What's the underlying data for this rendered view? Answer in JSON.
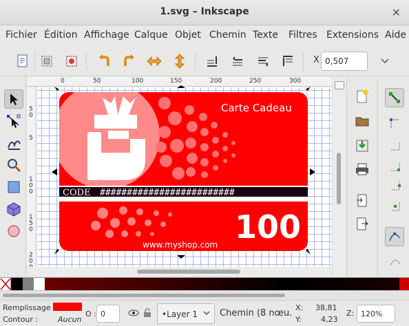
{
  "window": {
    "title": "1.svg – Inkscape",
    "close_glyph": "×"
  },
  "menu": {
    "items": [
      "Fichier",
      "Édition",
      "Affichage",
      "Calque",
      "Objet",
      "Chemin",
      "Texte",
      "Filtres",
      "Extensions",
      "Aide"
    ]
  },
  "toolbar": {
    "x_label": "X",
    "x_value": "0,507",
    "icons": [
      "document-properties-icon",
      "select-all-icon",
      "select-page-icon",
      "rotate-ccw-icon",
      "rotate-cw-icon",
      "flip-horizontal-icon",
      "flip-vertical-icon",
      "raise-to-top-icon",
      "raise-icon",
      "lower-icon",
      "lower-to-bottom-icon"
    ]
  },
  "rulers": {
    "top": [
      "0",
      "50",
      "100",
      "150",
      "200",
      "250",
      "300"
    ],
    "left": [
      "5",
      "0",
      "5",
      "1",
      "0",
      "0",
      "1",
      "5",
      "0",
      "2",
      "0",
      "0"
    ]
  },
  "card": {
    "title": "Carte Cadeau",
    "code_label": "CODE",
    "code_value": "#########################",
    "amount": "100",
    "url": "www.myshop.com",
    "colors": {
      "red": "#ff0000",
      "pink": "#ff8080",
      "dark": "#1a0010"
    }
  },
  "status": {
    "fill_label": "Remplissage :",
    "fill_color": "#ff0000",
    "stroke_label": "Contour :",
    "stroke_value": "Aucun",
    "opacity_label": "O :",
    "opacity_value": "0",
    "layer": "•Layer 1",
    "description": "Chemin (8 nœu...",
    "x_label": "X:",
    "x_value": "38,81",
    "y_label": "Y:",
    "y_value": "4,23",
    "z_label": "Z:",
    "zoom": "120%"
  }
}
